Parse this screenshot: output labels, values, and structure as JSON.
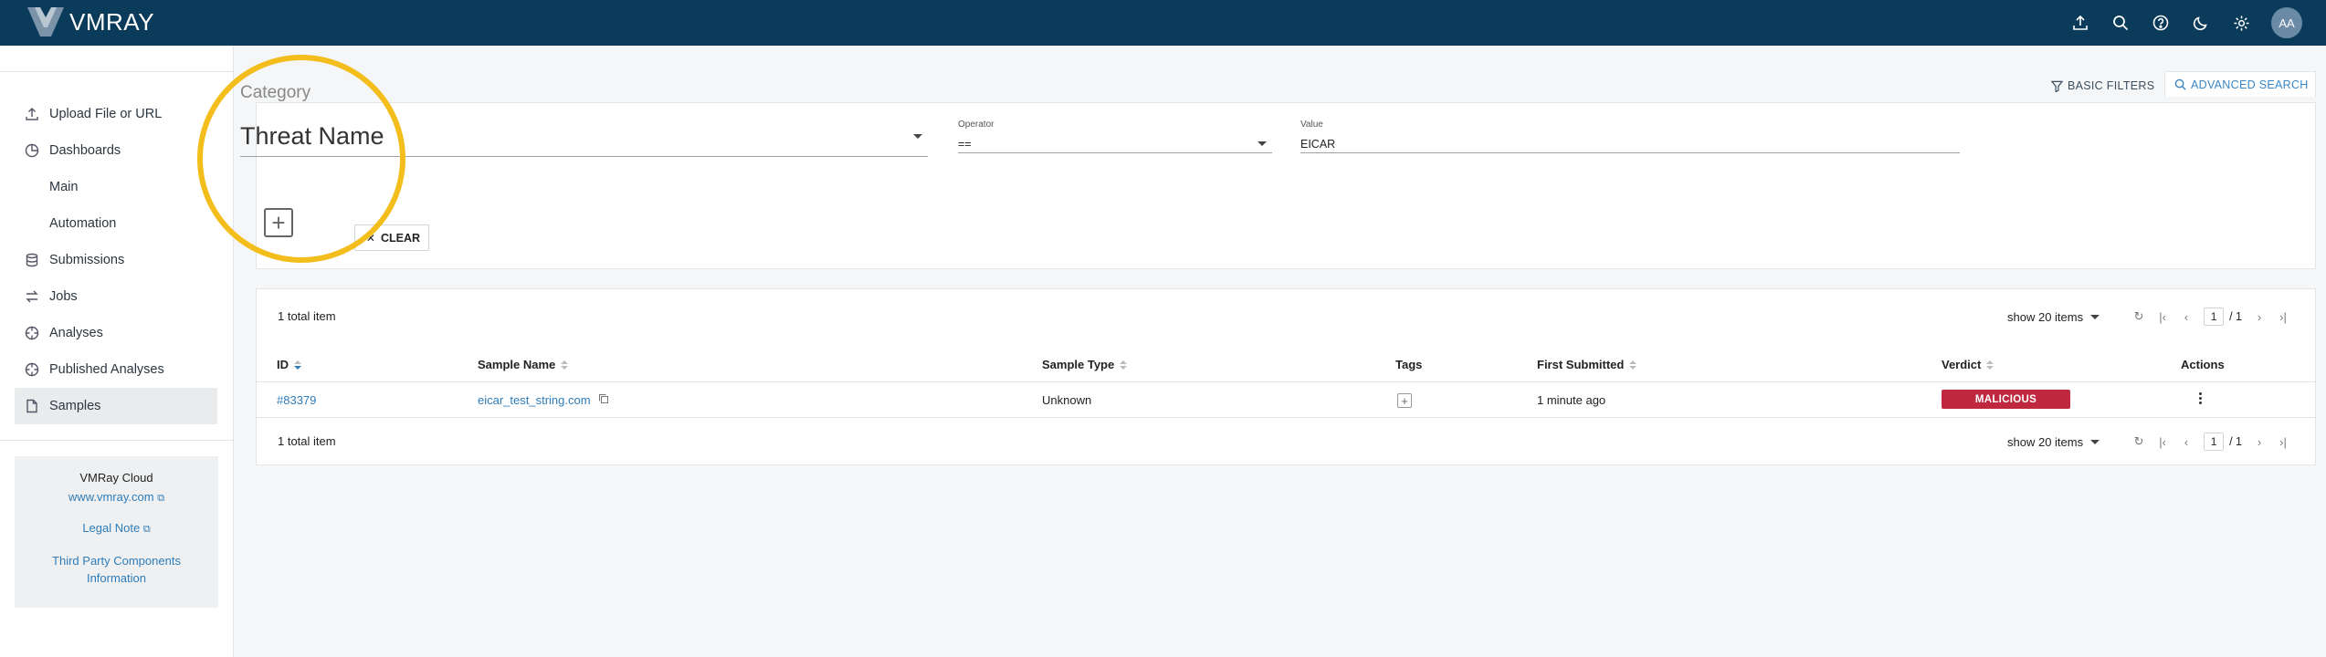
{
  "app": {
    "logo_text": "VMRAY",
    "avatar": "AA"
  },
  "topbar": {
    "icons": [
      "upload-icon",
      "search-icon",
      "help-icon",
      "dark-mode-icon",
      "gear-icon"
    ]
  },
  "sidebar": {
    "items": [
      {
        "label": "Upload File or URL",
        "icon": "upload-icon"
      },
      {
        "label": "Dashboards",
        "icon": "dashboard-icon"
      },
      {
        "label": "Main",
        "icon": ""
      },
      {
        "label": "Automation",
        "icon": ""
      },
      {
        "label": "Submissions",
        "icon": "database-icon"
      },
      {
        "label": "Jobs",
        "icon": "swap-icon"
      },
      {
        "label": "Analyses",
        "icon": "crosshair-icon"
      },
      {
        "label": "Published Analyses",
        "icon": "crosshair-icon"
      },
      {
        "label": "Samples",
        "icon": "file-icon",
        "active": true
      }
    ],
    "info": {
      "title": "VMRay Cloud",
      "website": "www.vmray.com",
      "legal": "Legal Note",
      "third_party": "Third Party Components Information"
    }
  },
  "filters": {
    "basic_label": "BASIC FILTERS",
    "advanced_label": "ADVANCED SEARCH",
    "category_label": "Category",
    "category_value": "Threat Name",
    "operator_label": "Operator",
    "operator_value": "==",
    "value_label": "Value",
    "value_value": "EICAR",
    "clear_label": "CLEAR"
  },
  "results": {
    "total_top": "1 total item",
    "total_bottom": "1 total item",
    "show_label": "show 20 items",
    "page": "1",
    "page_of": "/ 1",
    "columns": {
      "id": "ID",
      "sample_name": "Sample Name",
      "sample_type": "Sample Type",
      "tags": "Tags",
      "first_submitted": "First Submitted",
      "verdict": "Verdict",
      "actions": "Actions"
    },
    "rows": [
      {
        "id": "#83379",
        "sample_name": "eicar_test_string.com",
        "sample_type": "Unknown",
        "first_submitted": "1 minute ago",
        "verdict": "MALICIOUS",
        "verdict_color": "#c0283f"
      }
    ]
  },
  "colors": {
    "topbar": "#0b3b5a",
    "accent": "#2f7cb8",
    "highlight_ring": "#f3bd1b"
  }
}
